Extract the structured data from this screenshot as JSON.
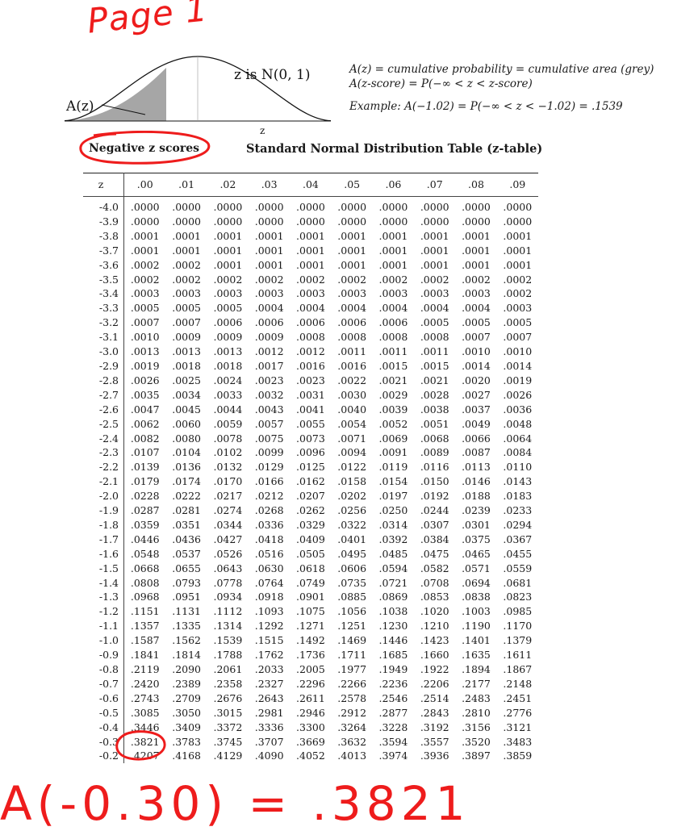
{
  "annotations": {
    "page_label": "Page 1",
    "bottom_note": "A(-0.30) = .3821",
    "ink_color": "#ee1c1c"
  },
  "figure": {
    "curve_label": "z is N(0, 1)",
    "area_label": "A(z)",
    "axis_label": "z",
    "shaded_color": "#a6a6a6"
  },
  "info": {
    "line1": "A(z) = cumulative probability = cumulative area (grey)",
    "line2": "A(z-score) = P(−∞ < z < z-score)",
    "example": "Example:  A(−1.02) = P(−∞ < z < −1.02) = .1539"
  },
  "section_label": "Negative z scores",
  "table_title": "Standard Normal Distribution Table (z-table)",
  "table": {
    "headers": [
      "z",
      ".00",
      ".01",
      ".02",
      ".03",
      ".04",
      ".05",
      ".06",
      ".07",
      ".08",
      ".09"
    ],
    "rows": [
      [
        "-4.0",
        ".0000",
        ".0000",
        ".0000",
        ".0000",
        ".0000",
        ".0000",
        ".0000",
        ".0000",
        ".0000",
        ".0000"
      ],
      [
        "-3.9",
        ".0000",
        ".0000",
        ".0000",
        ".0000",
        ".0000",
        ".0000",
        ".0000",
        ".0000",
        ".0000",
        ".0000"
      ],
      [
        "-3.8",
        ".0001",
        ".0001",
        ".0001",
        ".0001",
        ".0001",
        ".0001",
        ".0001",
        ".0001",
        ".0001",
        ".0001"
      ],
      [
        "-3.7",
        ".0001",
        ".0001",
        ".0001",
        ".0001",
        ".0001",
        ".0001",
        ".0001",
        ".0001",
        ".0001",
        ".0001"
      ],
      [
        "-3.6",
        ".0002",
        ".0002",
        ".0001",
        ".0001",
        ".0001",
        ".0001",
        ".0001",
        ".0001",
        ".0001",
        ".0001"
      ],
      [
        "-3.5",
        ".0002",
        ".0002",
        ".0002",
        ".0002",
        ".0002",
        ".0002",
        ".0002",
        ".0002",
        ".0002",
        ".0002"
      ],
      [
        "-3.4",
        ".0003",
        ".0003",
        ".0003",
        ".0003",
        ".0003",
        ".0003",
        ".0003",
        ".0003",
        ".0003",
        ".0002"
      ],
      [
        "-3.3",
        ".0005",
        ".0005",
        ".0005",
        ".0004",
        ".0004",
        ".0004",
        ".0004",
        ".0004",
        ".0004",
        ".0003"
      ],
      [
        "-3.2",
        ".0007",
        ".0007",
        ".0006",
        ".0006",
        ".0006",
        ".0006",
        ".0006",
        ".0005",
        ".0005",
        ".0005"
      ],
      [
        "-3.1",
        ".0010",
        ".0009",
        ".0009",
        ".0009",
        ".0008",
        ".0008",
        ".0008",
        ".0008",
        ".0007",
        ".0007"
      ],
      [
        "-3.0",
        ".0013",
        ".0013",
        ".0013",
        ".0012",
        ".0012",
        ".0011",
        ".0011",
        ".0011",
        ".0010",
        ".0010"
      ],
      [
        "-2.9",
        ".0019",
        ".0018",
        ".0018",
        ".0017",
        ".0016",
        ".0016",
        ".0015",
        ".0015",
        ".0014",
        ".0014"
      ],
      [
        "-2.8",
        ".0026",
        ".0025",
        ".0024",
        ".0023",
        ".0023",
        ".0022",
        ".0021",
        ".0021",
        ".0020",
        ".0019"
      ],
      [
        "-2.7",
        ".0035",
        ".0034",
        ".0033",
        ".0032",
        ".0031",
        ".0030",
        ".0029",
        ".0028",
        ".0027",
        ".0026"
      ],
      [
        "-2.6",
        ".0047",
        ".0045",
        ".0044",
        ".0043",
        ".0041",
        ".0040",
        ".0039",
        ".0038",
        ".0037",
        ".0036"
      ],
      [
        "-2.5",
        ".0062",
        ".0060",
        ".0059",
        ".0057",
        ".0055",
        ".0054",
        ".0052",
        ".0051",
        ".0049",
        ".0048"
      ],
      [
        "-2.4",
        ".0082",
        ".0080",
        ".0078",
        ".0075",
        ".0073",
        ".0071",
        ".0069",
        ".0068",
        ".0066",
        ".0064"
      ],
      [
        "-2.3",
        ".0107",
        ".0104",
        ".0102",
        ".0099",
        ".0096",
        ".0094",
        ".0091",
        ".0089",
        ".0087",
        ".0084"
      ],
      [
        "-2.2",
        ".0139",
        ".0136",
        ".0132",
        ".0129",
        ".0125",
        ".0122",
        ".0119",
        ".0116",
        ".0113",
        ".0110"
      ],
      [
        "-2.1",
        ".0179",
        ".0174",
        ".0170",
        ".0166",
        ".0162",
        ".0158",
        ".0154",
        ".0150",
        ".0146",
        ".0143"
      ],
      [
        "-2.0",
        ".0228",
        ".0222",
        ".0217",
        ".0212",
        ".0207",
        ".0202",
        ".0197",
        ".0192",
        ".0188",
        ".0183"
      ],
      [
        "-1.9",
        ".0287",
        ".0281",
        ".0274",
        ".0268",
        ".0262",
        ".0256",
        ".0250",
        ".0244",
        ".0239",
        ".0233"
      ],
      [
        "-1.8",
        ".0359",
        ".0351",
        ".0344",
        ".0336",
        ".0329",
        ".0322",
        ".0314",
        ".0307",
        ".0301",
        ".0294"
      ],
      [
        "-1.7",
        ".0446",
        ".0436",
        ".0427",
        ".0418",
        ".0409",
        ".0401",
        ".0392",
        ".0384",
        ".0375",
        ".0367"
      ],
      [
        "-1.6",
        ".0548",
        ".0537",
        ".0526",
        ".0516",
        ".0505",
        ".0495",
        ".0485",
        ".0475",
        ".0465",
        ".0455"
      ],
      [
        "-1.5",
        ".0668",
        ".0655",
        ".0643",
        ".0630",
        ".0618",
        ".0606",
        ".0594",
        ".0582",
        ".0571",
        ".0559"
      ],
      [
        "-1.4",
        ".0808",
        ".0793",
        ".0778",
        ".0764",
        ".0749",
        ".0735",
        ".0721",
        ".0708",
        ".0694",
        ".0681"
      ],
      [
        "-1.3",
        ".0968",
        ".0951",
        ".0934",
        ".0918",
        ".0901",
        ".0885",
        ".0869",
        ".0853",
        ".0838",
        ".0823"
      ],
      [
        "-1.2",
        ".1151",
        ".1131",
        ".1112",
        ".1093",
        ".1075",
        ".1056",
        ".1038",
        ".1020",
        ".1003",
        ".0985"
      ],
      [
        "-1.1",
        ".1357",
        ".1335",
        ".1314",
        ".1292",
        ".1271",
        ".1251",
        ".1230",
        ".1210",
        ".1190",
        ".1170"
      ],
      [
        "-1.0",
        ".1587",
        ".1562",
        ".1539",
        ".1515",
        ".1492",
        ".1469",
        ".1446",
        ".1423",
        ".1401",
        ".1379"
      ],
      [
        "-0.9",
        ".1841",
        ".1814",
        ".1788",
        ".1762",
        ".1736",
        ".1711",
        ".1685",
        ".1660",
        ".1635",
        ".1611"
      ],
      [
        "-0.8",
        ".2119",
        ".2090",
        ".2061",
        ".2033",
        ".2005",
        ".1977",
        ".1949",
        ".1922",
        ".1894",
        ".1867"
      ],
      [
        "-0.7",
        ".2420",
        ".2389",
        ".2358",
        ".2327",
        ".2296",
        ".2266",
        ".2236",
        ".2206",
        ".2177",
        ".2148"
      ],
      [
        "-0.6",
        ".2743",
        ".2709",
        ".2676",
        ".2643",
        ".2611",
        ".2578",
        ".2546",
        ".2514",
        ".2483",
        ".2451"
      ],
      [
        "-0.5",
        ".3085",
        ".3050",
        ".3015",
        ".2981",
        ".2946",
        ".2912",
        ".2877",
        ".2843",
        ".2810",
        ".2776"
      ],
      [
        "-0.4",
        ".3446",
        ".3409",
        ".3372",
        ".3336",
        ".3300",
        ".3264",
        ".3228",
        ".3192",
        ".3156",
        ".3121"
      ],
      [
        "-0.3",
        ".3821",
        ".3783",
        ".3745",
        ".3707",
        ".3669",
        ".3632",
        ".3594",
        ".3557",
        ".3520",
        ".3483"
      ],
      [
        "-0.2",
        ".4207",
        ".4168",
        ".4129",
        ".4090",
        ".4052",
        ".4013",
        ".3974",
        ".3936",
        ".3897",
        ".3859"
      ]
    ]
  }
}
